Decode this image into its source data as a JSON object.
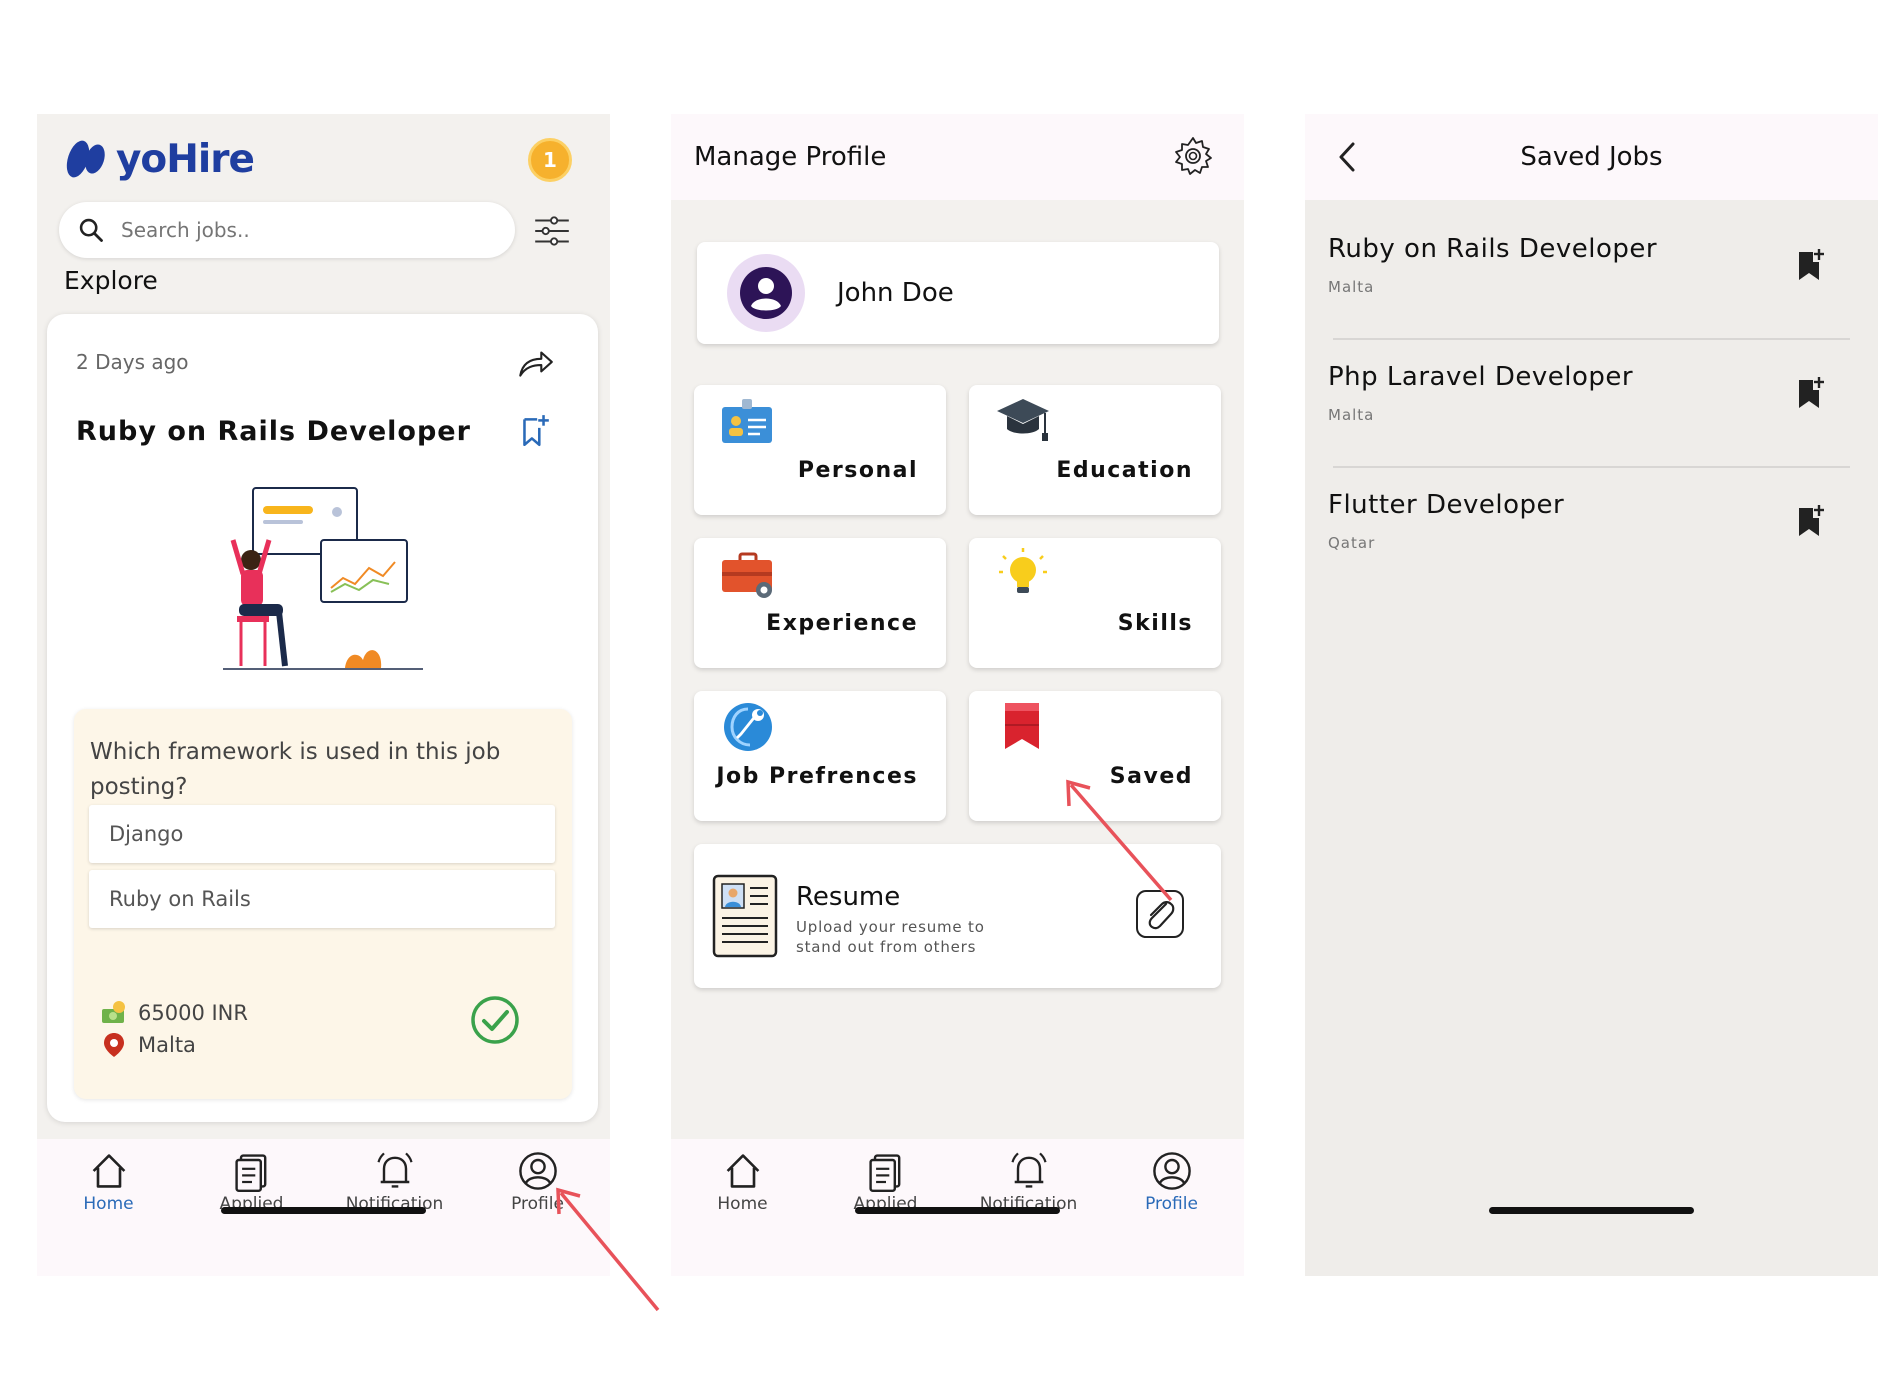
{
  "screen1": {
    "logo": "yoHire",
    "coin": "1",
    "search_placeholder": "Search jobs..",
    "section_title": "Explore",
    "card": {
      "posted": "2 Days ago",
      "title": "Ruby on Rails Developer",
      "question": "Which framework is used in this job posting?",
      "options": [
        "Django",
        "Ruby on Rails"
      ],
      "salary": "65000 INR",
      "location": "Malta"
    }
  },
  "screen2": {
    "title": "Manage Profile",
    "profile_name": "John Doe",
    "tiles": [
      "Personal",
      "Education",
      "Experience",
      "Skills",
      "Job Prefrences",
      "Saved"
    ],
    "resume": {
      "title": "Resume",
      "description": "Upload your resume to stand out from others"
    }
  },
  "screen3": {
    "title": "Saved Jobs",
    "jobs": [
      {
        "title": "Ruby on Rails Developer",
        "location": "Malta"
      },
      {
        "title": "Php Laravel Developer",
        "location": "Malta"
      },
      {
        "title": "Flutter Developer",
        "location": "Qatar"
      }
    ]
  },
  "nav": {
    "items": [
      "Home",
      "Applied",
      "Notification",
      "Profile"
    ]
  },
  "colors": {
    "accent": "#2a6ab8",
    "brand": "#1f3ea0",
    "arrow": "#e8525a",
    "check": "#3aa24b"
  }
}
